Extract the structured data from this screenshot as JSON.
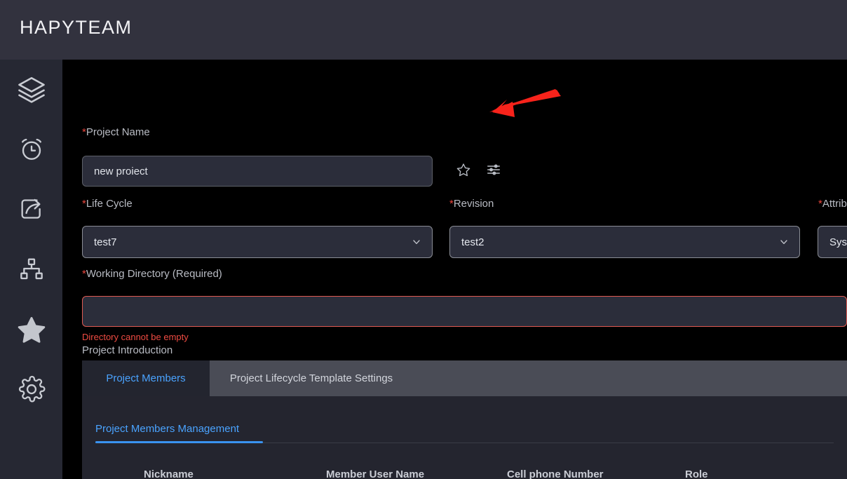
{
  "header": {
    "brand": "HAPYTEAM"
  },
  "sidebar": {
    "items": [
      {
        "icon": "layers-icon",
        "name": "sidebar-item-layers"
      },
      {
        "icon": "alarm-clock-icon",
        "name": "sidebar-item-schedule"
      },
      {
        "icon": "share-export-icon",
        "name": "sidebar-item-share"
      },
      {
        "icon": "sitemap-icon",
        "name": "sidebar-item-sitemap"
      },
      {
        "icon": "star-filled-icon",
        "name": "sidebar-item-favorites"
      },
      {
        "icon": "gear-icon",
        "name": "sidebar-item-settings"
      }
    ]
  },
  "form": {
    "project_name": {
      "label": "Project Name",
      "required_mark": "*",
      "value": "new proiect",
      "placeholder": ""
    },
    "life_cycle": {
      "label": "Life Cycle",
      "required_mark": "*",
      "value": "test7"
    },
    "revision": {
      "label": "Revision",
      "required_mark": "*",
      "value": "test2"
    },
    "attribute": {
      "label": "Attribute",
      "label_visible": "Attrib",
      "required_mark": "*",
      "value": "System",
      "value_visible": "Sy"
    },
    "working_directory": {
      "label": "Working Directory (Required)",
      "required_mark": "*",
      "value": "",
      "error": "Directory cannot be empty"
    },
    "project_introduction": {
      "label": "Project Introduction",
      "value": "",
      "placeholder": ""
    },
    "favorite_icon": "star-outline-icon",
    "settings_icon": "sliders-icon"
  },
  "tabs": [
    {
      "label": "Project Members",
      "active": true
    },
    {
      "label": "Project Lifecycle Template Settings",
      "active": false
    }
  ],
  "members_panel": {
    "title": "Project Members Management",
    "columns": [
      "Nickname",
      "Member User Name",
      "Cell phone Number",
      "Role"
    ],
    "rows": []
  },
  "annotation": {
    "type": "arrow",
    "color": "#f8231b",
    "points_to": "sliders-icon"
  },
  "colors": {
    "header_bg": "#32323e",
    "rail_bg": "#262833",
    "main_bg": "#000000",
    "field_bg": "#2b2d3a",
    "accent_blue": "#4aa3ff",
    "required_red": "#e8453c",
    "error_red": "#ef4b42",
    "tabbar_bg": "#4a4c56",
    "panel_bg": "#24252f"
  }
}
